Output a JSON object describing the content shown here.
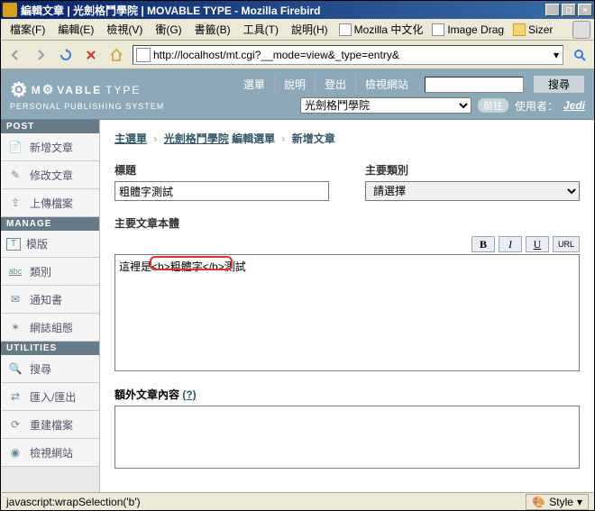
{
  "window": {
    "title": "編輯文章 | 光劍格鬥學院 | MOVABLE TYPE - Mozilla Firebird",
    "min": "_",
    "max": "□",
    "close": "×"
  },
  "menu": {
    "file": "檔案(F)",
    "edit": "編輯(E)",
    "view": "檢視(V)",
    "go": "衝(G)",
    "bookmarks": "書籤(B)",
    "tools": "工具(T)",
    "help": "說明(H)",
    "bm1": "Mozilla 中文化",
    "bm2": "Image Drag",
    "bm3": "Sizer"
  },
  "toolbar": {
    "url": "http://localhost/mt.cgi?__mode=view&_type=entry&"
  },
  "mt": {
    "logo1": "M",
    "logo2": "VABLE",
    "logo3": "TYPE",
    "sub": "PERSONAL PUBLISHING SYSTEM",
    "nav": {
      "menu": "選單",
      "help": "說明",
      "logout": "登出",
      "viewsite": "檢視網站",
      "search": "搜尋"
    },
    "blog_selected": "光劍格鬥學院",
    "go": "前往",
    "user_label": "使用者：",
    "user": "Jedi"
  },
  "sidebar": {
    "post_hdr": "POST",
    "post": [
      {
        "icon": "📄",
        "label": "新增文章"
      },
      {
        "icon": "✎",
        "label": "修改文章"
      },
      {
        "icon": "⇪",
        "label": "上傳檔案"
      }
    ],
    "manage_hdr": "MANAGE",
    "manage": [
      {
        "icon": "T",
        "label": "模版"
      },
      {
        "icon": "abc",
        "label": "類別"
      },
      {
        "icon": "✉",
        "label": "通知書"
      },
      {
        "icon": "✶",
        "label": "網誌組態"
      }
    ],
    "util_hdr": "UTILITIES",
    "util": [
      {
        "icon": "🔍",
        "label": "搜尋"
      },
      {
        "icon": "⇄",
        "label": "匯入/匯出"
      },
      {
        "icon": "⟳",
        "label": "重建檔案"
      },
      {
        "icon": "◉",
        "label": "檢視網站"
      }
    ]
  },
  "breadcrumb": {
    "a": "主選單",
    "b": "光劍格鬥學院",
    "c": "編輯選單",
    "d": "新增文章",
    "sep": "›"
  },
  "form": {
    "title_label": "標題",
    "title_value": "粗體字測試",
    "cat_label": "主要類別",
    "cat_value": "請選擇",
    "body_label": "主要文章本體",
    "fmt": {
      "b": "B",
      "i": "I",
      "u": "U",
      "url": "URL"
    },
    "body_value": "這裡是<b>粗體字</b>測試",
    "ext_label": "額外文章內容",
    "ext_help": "(?)"
  },
  "status": {
    "text": "javascript:wrapSelection('b')",
    "style": "Style"
  }
}
